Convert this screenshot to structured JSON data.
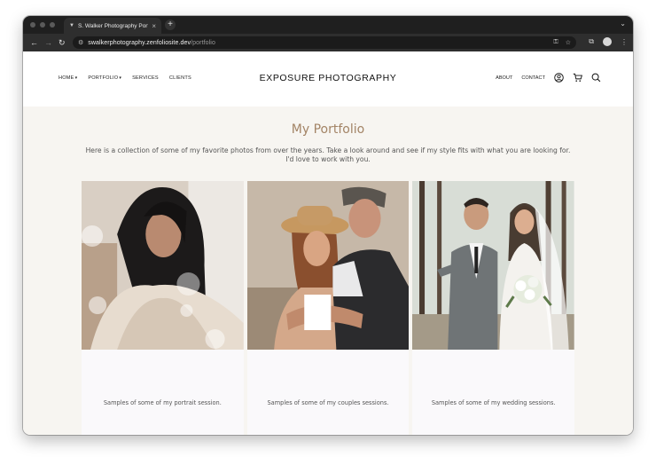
{
  "browser": {
    "tab_title": "S. Walker Photography Portfo",
    "url_host": "swalkerphotography.zenfoliosite.dev",
    "url_path": "/portfolio"
  },
  "site": {
    "brand": "EXPOSURE PHOTOGRAPHY",
    "nav_left": [
      "HOME",
      "PORTFOLIO",
      "SERVICES",
      "CLIENTS"
    ],
    "nav_right": [
      "ABOUT",
      "CONTACT"
    ]
  },
  "portfolio": {
    "title": "My Portfolio",
    "intro": "Here is a collection of some of my favorite photos from over the years. Take a look around and see if my style fits with what you are looking for. I'd love to work with you.",
    "cards": [
      {
        "caption": "Samples of some of my portrait session."
      },
      {
        "caption": "Samples of some of my couples sessions."
      },
      {
        "caption": "Samples of some of my wedding sessions."
      }
    ]
  }
}
